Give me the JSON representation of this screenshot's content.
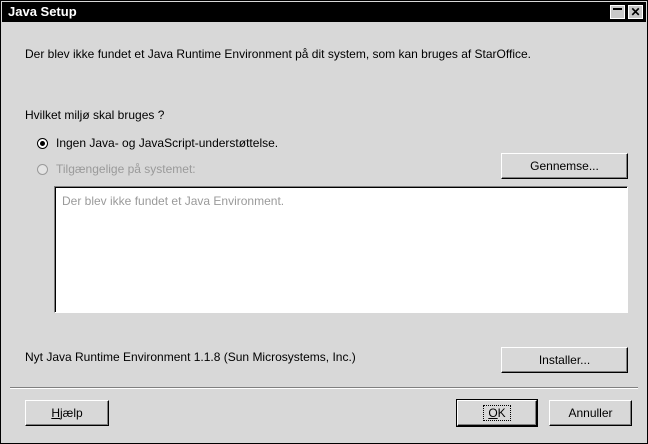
{
  "window": {
    "title": "Java Setup"
  },
  "message": "Der blev ikke fundet et Java Runtime Environment på dit system, som kan bruges af StarOffice.",
  "question": "Hvilket miljø skal bruges ?",
  "options": [
    {
      "label": "Ingen Java- og JavaScript-understøttelse.",
      "selected": true,
      "enabled": true
    },
    {
      "label": "Tilgængelige på systemet:",
      "selected": false,
      "enabled": false
    }
  ],
  "browse_button": "Gennemse...",
  "list_message": "Der blev ikke fundet et Java Environment.",
  "new_jre": "Nyt Java Runtime Environment 1.1.8 (Sun Microsystems, Inc.)",
  "install_button": "Installer...",
  "help_button": {
    "mnemonic": "H",
    "rest": "jælp"
  },
  "ok_button": {
    "mnemonic": "O",
    "rest": "K"
  },
  "cancel_button": "Annuller"
}
